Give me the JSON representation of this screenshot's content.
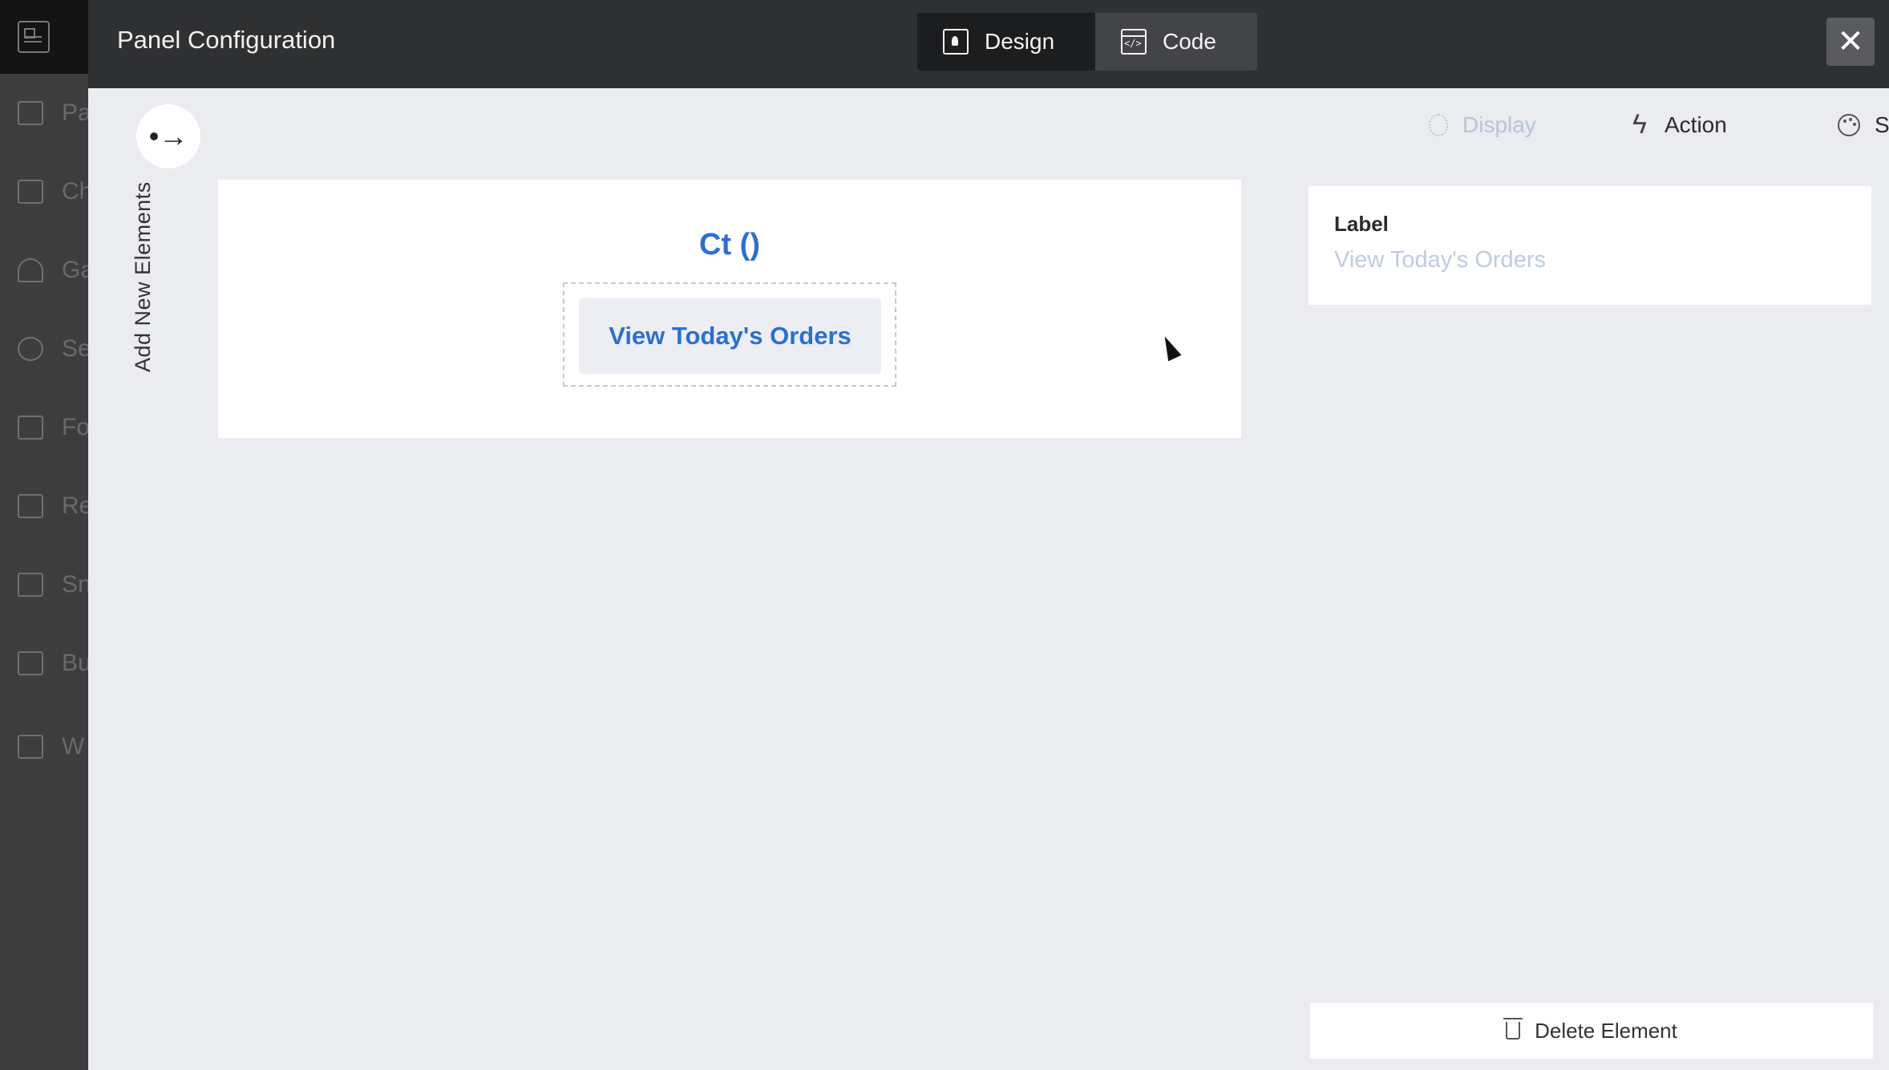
{
  "modal": {
    "title": "Panel Configuration",
    "close_glyph": "✕"
  },
  "modes": {
    "design": "Design",
    "code": "Code"
  },
  "bg_sidebar": {
    "items": [
      {
        "label": "Pa"
      },
      {
        "label": "Ch"
      },
      {
        "label": "Ga"
      },
      {
        "label": "Se"
      },
      {
        "label": "Fo"
      },
      {
        "label": "Re"
      },
      {
        "label": "Sn"
      },
      {
        "label": "Bu"
      },
      {
        "label": "W"
      }
    ]
  },
  "left": {
    "expand_glyph": "•→",
    "add_elements_label": "Add New Elements"
  },
  "canvas": {
    "heading": "Ct ()",
    "button_label": "View Today's Orders"
  },
  "properties": {
    "tabs": {
      "display": "Display",
      "action": "Action",
      "style": "Style"
    },
    "label_title": "Label",
    "label_value": "View Today's Orders",
    "delete_label": "Delete Element"
  }
}
